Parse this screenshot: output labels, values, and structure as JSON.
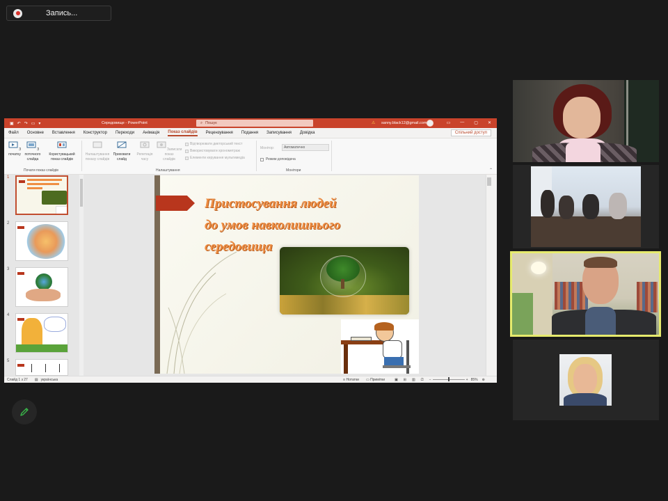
{
  "recording": {
    "label": "Запись..."
  },
  "ppt": {
    "titlebar": {
      "doc_title": "Середовище - PowerPoint",
      "search_placeholder": "Пошук",
      "user_email": "sanny.black12@gmail.com"
    },
    "tabs": [
      "Файл",
      "Основне",
      "Вставлення",
      "Конструктор",
      "Переходи",
      "Анімація",
      "Показ слайдів",
      "Рецензування",
      "Подання",
      "Записування",
      "Довідка"
    ],
    "active_tab": "Показ слайдів",
    "share_label": "Спільний доступ",
    "ribbon": {
      "start_group": {
        "label": "Почати показ слайдів",
        "buttons": [
          {
            "label": "З\nпочатку",
            "enabled": true
          },
          {
            "label": "З поточного\nслайда",
            "enabled": true
          },
          {
            "label": "Користувацький\nпоказ слайдів",
            "enabled": true
          }
        ]
      },
      "setup_group": {
        "label": "Налаштування",
        "buttons": [
          {
            "label": "Налаштування\nпоказу слайдів",
            "enabled": false
          },
          {
            "label": "Приховати\nслайд",
            "enabled": true
          },
          {
            "label": "Репетиція\nчасу",
            "enabled": false
          },
          {
            "label": "Записати показ\nслайдів",
            "enabled": false
          }
        ],
        "checkboxes": [
          "Відтворювати дикторський текст",
          "Використовувати хронометраж",
          "Елементи керування мультимедіа"
        ]
      },
      "monitors_group": {
        "label": "Монітори",
        "monitor_label": "Монітор:",
        "monitor_value": "Автоматично",
        "presenter_view_label": "Режим доповідача"
      }
    },
    "thumbnails": [
      {
        "num": "1",
        "selected": true
      },
      {
        "num": "2",
        "selected": false
      },
      {
        "num": "3",
        "selected": false
      },
      {
        "num": "4",
        "selected": false
      },
      {
        "num": "5",
        "selected": false
      }
    ],
    "slide": {
      "title_line1": "Пристосування людей",
      "title_line2": "до умов навколишнього",
      "title_line3": "середовища"
    },
    "status": {
      "slide_info": "Слайд 1 з 27",
      "language": "українська",
      "notes": "Нотатки",
      "comments": "Примітки",
      "zoom": "85%"
    }
  },
  "colors": {
    "ppt_accent": "#c9432b",
    "speaker_border": "#e6ea6d",
    "background": "#1a1a1a"
  },
  "icons": {
    "record": "record-icon",
    "annotate": "pencil-icon"
  }
}
